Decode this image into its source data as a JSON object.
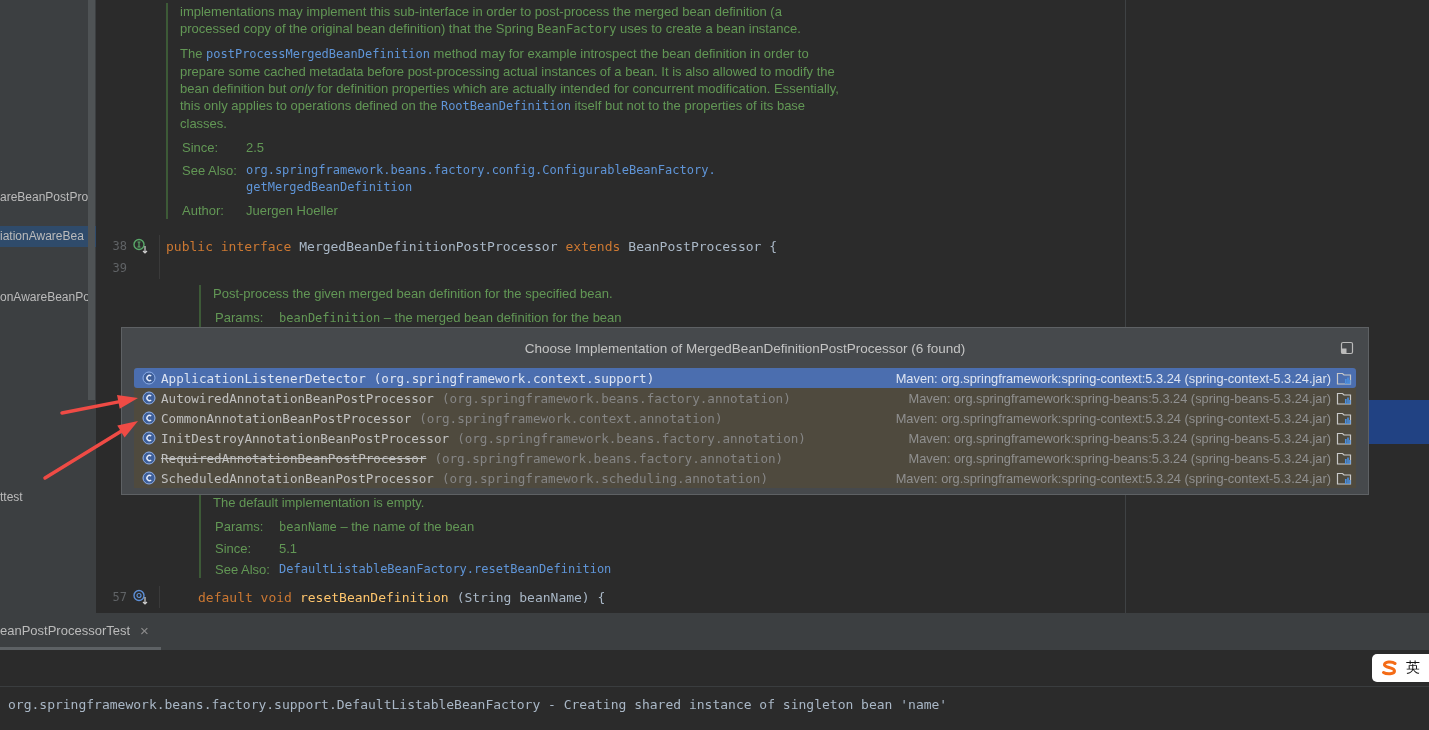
{
  "sidebar": {
    "items": [
      {
        "label": "areBeanPostPro",
        "selected": false
      },
      {
        "label": "iationAwareBea",
        "selected": true
      },
      {
        "label": "onAwareBeanPo",
        "selected": false
      },
      {
        "label": "ttest",
        "selected": false
      }
    ]
  },
  "editor": {
    "blocks": [
      {
        "kind": "doc",
        "nested": false,
        "paragraphs": [
          [
            {
              "kind": "text",
              "text": "implementations may implement this sub-interface in order to post-process the merged bean definition (a processed copy of the original bean definition) that the Spring "
            },
            {
              "kind": "mono",
              "text": "BeanFactory"
            },
            {
              "kind": "text",
              "text": " uses to create a bean instance."
            }
          ],
          [
            {
              "kind": "text",
              "text": "The "
            },
            {
              "kind": "link",
              "text": "postProcessMergedBeanDefinition"
            },
            {
              "kind": "text",
              "text": " method may for example introspect the bean definition in order to prepare some cached metadata before post-processing actual instances of a bean. It is also allowed to modify the bean definition but "
            },
            {
              "kind": "em",
              "text": "only"
            },
            {
              "kind": "text",
              "text": " for definition properties which are actually intended for concurrent modification. Essentially, this only applies to operations defined on the "
            },
            {
              "kind": "link",
              "text": "RootBeanDefinition"
            },
            {
              "kind": "text",
              "text": " itself but not to the properties of its base classes."
            }
          ]
        ],
        "fields": [
          {
            "label": "Since:",
            "value": [
              {
                "kind": "text",
                "text": "2.5"
              }
            ]
          },
          {
            "label": "See Also:",
            "value": [
              {
                "kind": "link",
                "text": "org.springframework.beans.factory.config.ConfigurableBeanFactory."
              },
              {
                "kind": "link",
                "text": "getMergedBeanDefinition"
              }
            ]
          },
          {
            "label": "Author:",
            "value": [
              {
                "kind": "text",
                "text": "Juergen Hoeller"
              }
            ]
          }
        ]
      },
      {
        "kind": "code",
        "number": "38",
        "implemented": true,
        "tokens": [
          {
            "kind": "keyword",
            "text": "public interface"
          },
          {
            "kind": "plain",
            "text": "MergedBeanDefinitionPostProcessor"
          },
          {
            "kind": "keyword",
            "text": "extends"
          },
          {
            "kind": "plain",
            "text": "BeanPostProcessor {"
          }
        ]
      },
      {
        "kind": "code",
        "number": "39"
      },
      {
        "kind": "doc",
        "nested": true,
        "paragraphs": [
          [
            {
              "kind": "text",
              "text": "Post-process the given merged bean definition for the specified bean."
            }
          ]
        ],
        "fields": [
          {
            "label": "Params:",
            "value": [
              {
                "kind": "mono",
                "text": "beanDefinition"
              },
              {
                "kind": "text",
                "text": " – the merged bean definition for the bean"
              }
            ]
          }
        ]
      },
      {
        "kind": "doc",
        "nested": true,
        "gap_before": true,
        "paragraphs": [
          [
            {
              "kind": "text",
              "text": "The default implementation is empty."
            }
          ]
        ],
        "fields": [
          {
            "label": "Params:",
            "value": [
              {
                "kind": "mono",
                "text": "beanName"
              },
              {
                "kind": "text",
                "text": " – the name of the bean"
              }
            ]
          },
          {
            "label": "Since:",
            "value": [
              {
                "kind": "text",
                "text": "5.1"
              }
            ]
          },
          {
            "label": "See Also:",
            "value": [
              {
                "kind": "link",
                "text": "DefaultListableBeanFactory.resetBeanDefinition"
              }
            ]
          }
        ]
      },
      {
        "kind": "code",
        "number": "57",
        "overridden": true,
        "indented": true,
        "tokens": [
          {
            "kind": "keyword",
            "text": "default void"
          },
          {
            "kind": "method",
            "text": "resetBeanDefinition"
          },
          {
            "kind": "plain",
            "text": "(String beanName) {"
          }
        ]
      }
    ]
  },
  "popup": {
    "title": "Choose Implementation of MergedBeanDefinitionPostProcessor (6 found)",
    "items": [
      {
        "name": "ApplicationListenerDetector",
        "package": "(org.springframework.context.support)",
        "source": "Maven: org.springframework:spring-context:5.3.24 (spring-context-5.3.24.jar)",
        "selected": true,
        "deprecated": false
      },
      {
        "name": "AutowiredAnnotationBeanPostProcessor",
        "package": "(org.springframework.beans.factory.annotation)",
        "source": "Maven: org.springframework:spring-beans:5.3.24 (spring-beans-5.3.24.jar)",
        "selected": false,
        "deprecated": false
      },
      {
        "name": "CommonAnnotationBeanPostProcessor",
        "package": "(org.springframework.context.annotation)",
        "source": "Maven: org.springframework:spring-context:5.3.24 (spring-context-5.3.24.jar)",
        "selected": false,
        "deprecated": false
      },
      {
        "name": "InitDestroyAnnotationBeanPostProcessor",
        "package": "(org.springframework.beans.factory.annotation)",
        "source": "Maven: org.springframework:spring-beans:5.3.24 (spring-beans-5.3.24.jar)",
        "selected": false,
        "deprecated": false
      },
      {
        "name": "RequiredAnnotationBeanPostProcessor",
        "package": "(org.springframework.beans.factory.annotation)",
        "source": "Maven: org.springframework:spring-beans:5.3.24 (spring-beans-5.3.24.jar)",
        "selected": false,
        "deprecated": true
      },
      {
        "name": "ScheduledAnnotationBeanPostProcessor",
        "package": "(org.springframework.scheduling.annotation)",
        "source": "Maven: org.springframework:spring-context:5.3.24 (spring-context-5.3.24.jar)",
        "selected": false,
        "deprecated": false
      }
    ]
  },
  "annotations": [
    {
      "kind": "arrow"
    },
    {
      "kind": "arrow"
    }
  ],
  "tool_window": {
    "tabs": [
      {
        "label": "eanPostProcessorTest",
        "close": "×",
        "selected": true
      }
    ],
    "log_lines": [
      "org.springframework.beans.factory.support.DefaultListableBeanFactory - Creating shared instance of singleton bean 'name'"
    ]
  },
  "ime": {
    "label": "英"
  }
}
